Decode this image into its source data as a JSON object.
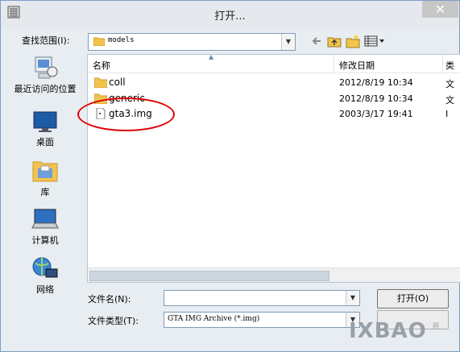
{
  "window": {
    "title": "打开..."
  },
  "toolbar": {
    "lookin_label": "查找范围(I):",
    "lookin_value": "models"
  },
  "places": [
    {
      "label": "最近访问的位置"
    },
    {
      "label": "桌面"
    },
    {
      "label": "库"
    },
    {
      "label": "计算机"
    },
    {
      "label": "网络"
    }
  ],
  "list": {
    "columns": {
      "name": "名称",
      "date": "修改日期",
      "type": "类"
    },
    "rows": [
      {
        "name": "coll",
        "date": "2012/8/19 10:34",
        "type": "文",
        "kind": "folder"
      },
      {
        "name": "generic",
        "date": "2012/8/19 10:34",
        "type": "文",
        "kind": "folder"
      },
      {
        "name": "gta3.img",
        "date": "2003/3/17 19:41",
        "type": "I",
        "kind": "file"
      }
    ]
  },
  "bottom": {
    "filename_label": "文件名(N):",
    "filename_value": "",
    "filetype_label": "文件类型(T):",
    "filetype_value": "GTA IMG Archive (*.img)",
    "open_label": "打开(O)"
  },
  "watermark": {
    "text": "IXBAO",
    "sub": "网"
  },
  "colors": {
    "highlight_circle": "#e00000",
    "folder": "#f3c44d"
  }
}
